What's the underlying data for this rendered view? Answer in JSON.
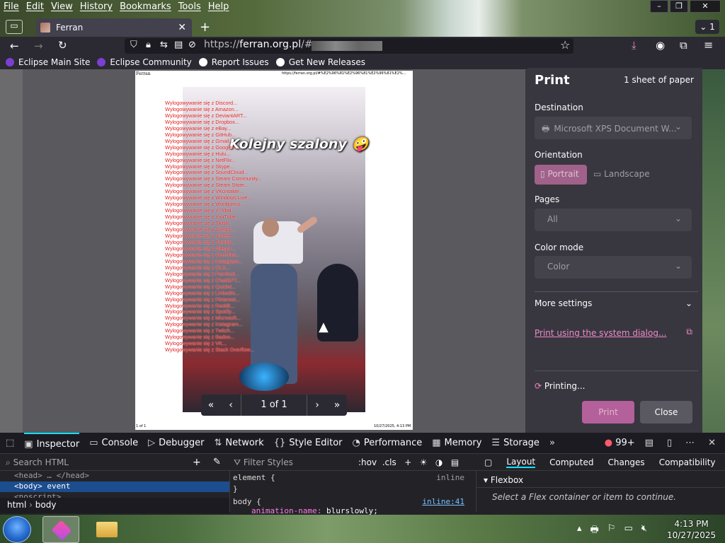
{
  "menubar": [
    "File",
    "Edit",
    "View",
    "History",
    "Bookmarks",
    "Tools",
    "Help"
  ],
  "window": {
    "minimize": "–",
    "maximize": "❐",
    "close": "✕"
  },
  "tab": {
    "title": "Ferran",
    "close": "✕"
  },
  "tab_count": "1",
  "url": {
    "scheme": "https://",
    "domain": "ferran.org.pl",
    "path": "/#"
  },
  "bookmarks": [
    {
      "label": "Eclipse Main Site",
      "icon": "eclipse-icon",
      "color": "#7b3fd1"
    },
    {
      "label": "Eclipse Community",
      "icon": "eclipse-icon",
      "color": "#7b3fd1"
    },
    {
      "label": "Report Issues",
      "icon": "github-icon",
      "color": "#ffffff"
    },
    {
      "label": "Get New Releases",
      "icon": "github-icon",
      "color": "#ffffff"
    }
  ],
  "preview": {
    "page_header_title": "Ferran",
    "page_header_url": "https://ferran.org.pl/#%E2%96%81%E2%96%81%E2%96%81%E2%...",
    "footer_page": "1 of 1",
    "footer_date": "10/27/2025, 4:13 PM",
    "caption": "Kolejny szalony 🤪",
    "login_lines": [
      "Wylogowywanie się z Discord...",
      "Wylogowywanie się z Amazon...",
      "Wylogowywanie się z DeviantART...",
      "Wylogowywanie się z Dropbox...",
      "Wylogowywanie się z eBay...",
      "Wylogowywanie się z GitHub...",
      "Wylogowywanie się z Gmail...",
      "Wylogowywanie się z Google+...",
      "Wylogowywanie się z Hulu...",
      "Wylogowywanie się z NetFlix...",
      "Wylogowywanie się z Skype...",
      "Wylogowywanie się z SoundCloud...",
      "Wylogowywanie się z Steam Community...",
      "Wylogowywanie się z Steam Store...",
      "Wylogowywanie się z VKontakte...",
      "Wylogowywanie się z Windows Live...",
      "Wylogowywanie się z Wordpress...",
      "Wylogowywanie się z Y! Mail...",
      "Wylogowywanie się z YouTube...",
      "Wylogowywanie się z Tiktok...",
      "Wylogowywanie się z Allegro...",
      "Wylogowywanie się z Vinted...",
      "Wylogowywanie się z Tumblr...",
      "Wylogowywanie się z Allegro...",
      "Wylogowywanie się z OneShot...",
      "Wylogowywanie się z Instagram...",
      "Wylogowywanie się z OLX...",
      "Wylogowywanie się z Pornhub...",
      "Wylogowywanie się z ChatGPT...",
      "Wylogowywanie się z Quizlet...",
      "Wylogowywanie się z LinkedIn...",
      "Wylogowywanie się z Pinterest...",
      "Wylogowywanie się z Reddit...",
      "Wylogowywanie się z Spotify...",
      "Wylogowywanie się z Microsoft...",
      "Wylogowywanie się z Instagram...",
      "Wylogowywanie się z Twitch...",
      "Wylogowywanie się z Badoo...",
      "Wylogowywanie się z VK...",
      "Wylogowywanie się z Stack Overflow..."
    ]
  },
  "pager": {
    "first": "«",
    "prev": "‹",
    "text": "1 of 1",
    "next": "›",
    "last": "»"
  },
  "print_panel": {
    "title": "Print",
    "sheets": "1 sheet of paper",
    "destination_label": "Destination",
    "destination_value": "Microsoft XPS Document W...",
    "orientation_label": "Orientation",
    "portrait": "Portrait",
    "landscape": "Landscape",
    "pages_label": "Pages",
    "pages_value": "All",
    "color_label": "Color mode",
    "color_value": "Color",
    "more_settings": "More settings",
    "system_dialog": "Print using the system dialog...",
    "status": "Printing...",
    "print_btn": "Print",
    "close_btn": "Close",
    "accent": "#b4609a"
  },
  "devtools": {
    "tabs": [
      "Inspector",
      "Console",
      "Debugger",
      "Network",
      "Style Editor",
      "Performance",
      "Memory",
      "Storage"
    ],
    "error_count": "99+",
    "search_placeholder": "Search HTML",
    "filter_placeholder": "Filter Styles",
    "pseudo": ":hov",
    "cls": ".cls",
    "right_tabs": [
      "Layout",
      "Computed",
      "Changes",
      "Compatibility"
    ],
    "tree": [
      "<head> … </head>",
      "<body> event",
      "<noscript>"
    ],
    "rules": [
      {
        "selector": "element",
        "brace": "{",
        "source": "inline"
      },
      {
        "selector": "}",
        "brace": "",
        "source": ""
      },
      {
        "selector": "body",
        "brace": "{",
        "source": "inline:41"
      },
      {
        "selector": "animation-name:",
        "brace": "blurslowly;",
        "source": ""
      }
    ],
    "flexbox": "Flexbox",
    "flex_hint": "Select a Flex container or item to continue.",
    "crumbs": [
      "html",
      "body"
    ]
  },
  "taskbar": {
    "time": "4:13 PM",
    "date": "10/27/2025"
  }
}
